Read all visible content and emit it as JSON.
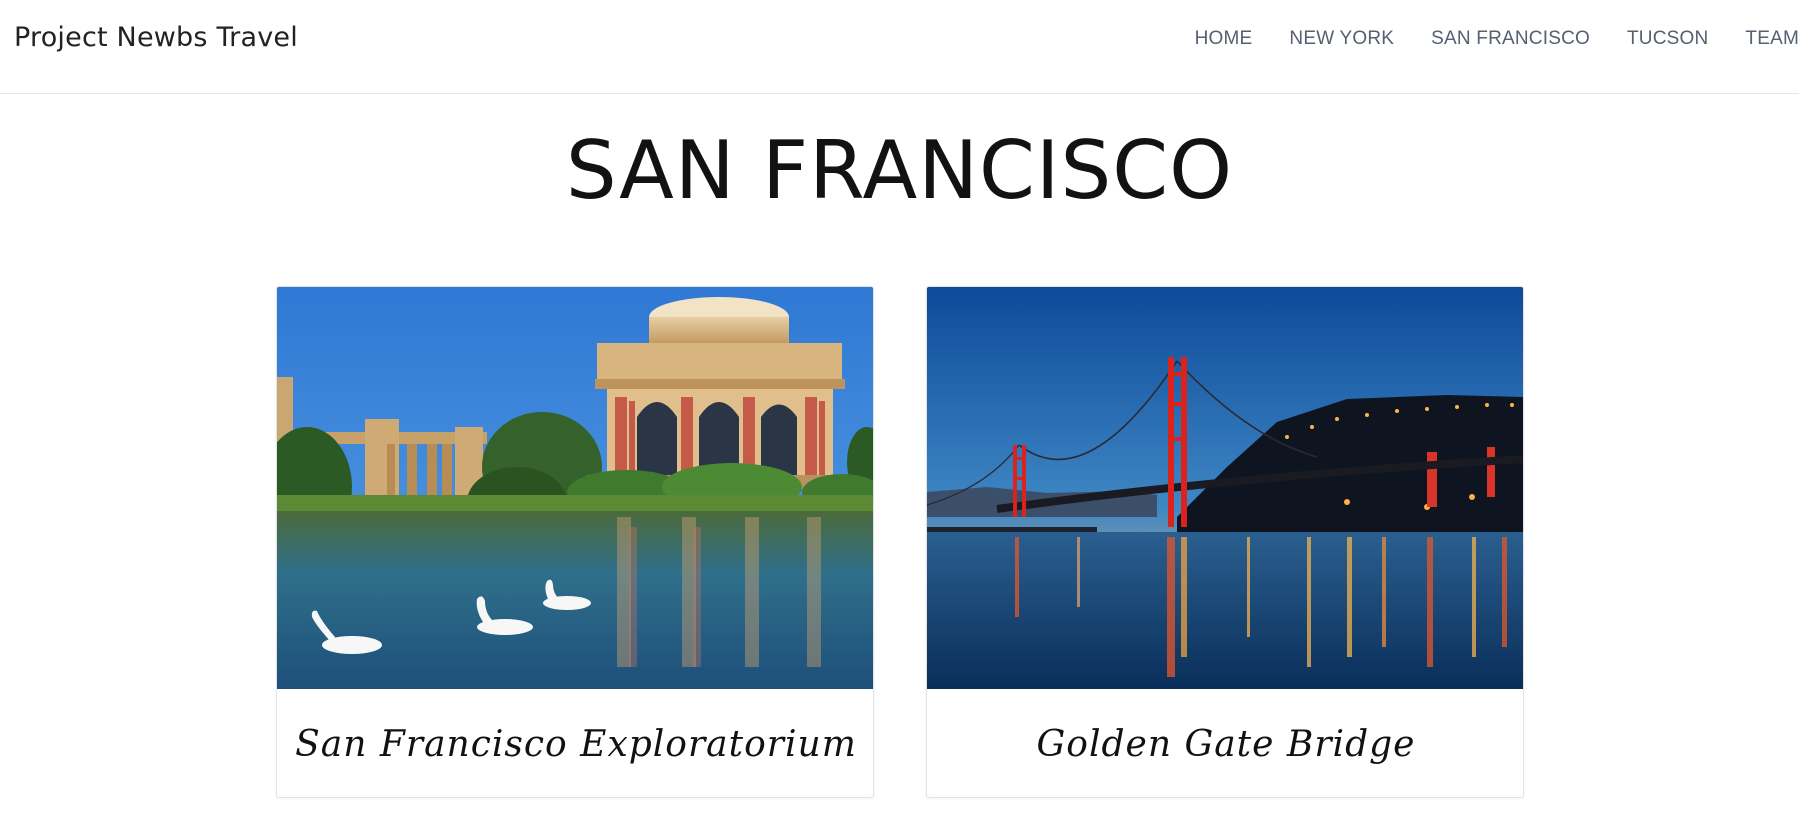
{
  "header": {
    "brand": "Project Newbs Travel",
    "nav": [
      {
        "label": "HOME"
      },
      {
        "label": "NEW YORK"
      },
      {
        "label": "SAN FRANCISCO"
      },
      {
        "label": "TUCSON"
      },
      {
        "label": "TEAM"
      }
    ]
  },
  "main": {
    "title": "SAN FRANCISCO",
    "cards": [
      {
        "caption": "San Francisco Exploratorium",
        "image": "palace-of-fine-arts-photo"
      },
      {
        "caption": "Golden Gate Bridge",
        "image": "golden-gate-bridge-photo"
      }
    ]
  },
  "colors": {
    "nav_text": "#556070",
    "title_text": "#121212",
    "border": "#e3e3e3"
  }
}
